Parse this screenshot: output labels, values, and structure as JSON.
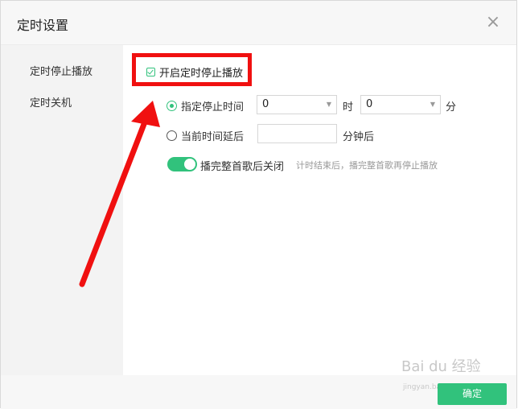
{
  "dialog": {
    "title": "定时设置",
    "close_glyph": "×"
  },
  "sidebar": {
    "items": [
      {
        "label": "定时停止播放"
      },
      {
        "label": "定时关机"
      }
    ]
  },
  "stop_playback": {
    "enable_label": "开启定时停止播放",
    "enabled": true,
    "option_specific_time": {
      "label": "指定停止时间",
      "selected": true,
      "hour_value": "0",
      "hour_unit": "时",
      "minute_value": "0",
      "minute_unit": "分"
    },
    "option_delay": {
      "label": "当前时间延后",
      "selected": false,
      "value": "",
      "unit": "分钟后"
    },
    "finish_song": {
      "label": "播完整首歌后关闭",
      "enabled": true,
      "hint": "计时结束后，播完整首歌再停止播放"
    }
  },
  "footer": {
    "ok_label": "确定"
  },
  "watermark": {
    "main": "Bai du 经验",
    "sub": "jingyan.baidu.com"
  },
  "colors": {
    "accent": "#31c27c",
    "annotation": "#f01010"
  }
}
